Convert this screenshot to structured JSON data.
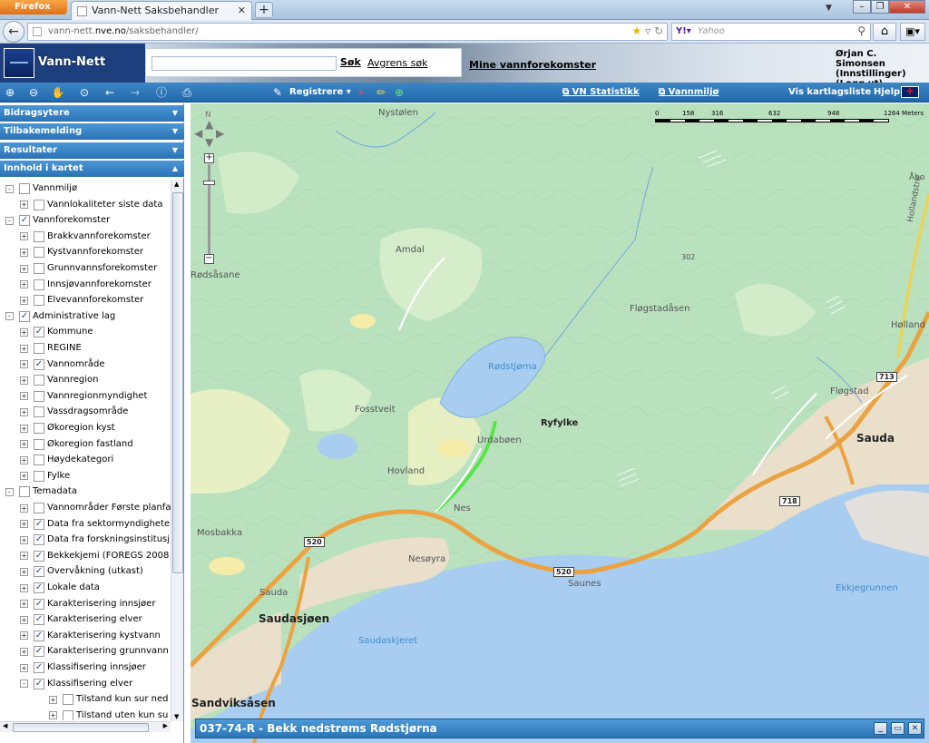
{
  "browser": {
    "app_menu": "Firefox",
    "tab_title": "Vann-Nett Saksbehandler",
    "url_plain": "vann-nett.",
    "url_host": "nve.no",
    "url_path": "/saksbehandler/",
    "search_engine_placeholder": "Yahoo"
  },
  "header": {
    "app_title": "Vann-Nett",
    "search_button": "Søk",
    "refine_button": "Avgrens søk",
    "my_waters_link": "Mine vannforekomster",
    "user_name": "Ørjan C. Simonsen",
    "settings_link": "(Innstillinger)",
    "logout_link": "(Logg ut)"
  },
  "toolbar": {
    "register_label": "Registrere",
    "vn_stats": "VN Statistikk",
    "vannmiljo": "Vannmiljø",
    "layer_list": "Vis kartlagsliste",
    "help": "Hjelp"
  },
  "sidebar": {
    "panels": [
      "Bidragsytere",
      "Tilbakemelding",
      "Resultater",
      "Innhold i kartet"
    ],
    "tree": [
      {
        "level": 0,
        "label": "Vannmiljø",
        "checked": false,
        "exp": "-"
      },
      {
        "level": 1,
        "label": "Vannlokaliteter siste data",
        "checked": false,
        "exp": "+"
      },
      {
        "level": 0,
        "label": "Vannforekomster",
        "checked": true,
        "exp": "-"
      },
      {
        "level": 1,
        "label": "Brakkvannforekomster",
        "checked": false,
        "exp": "+"
      },
      {
        "level": 1,
        "label": "Kystvannforekomster",
        "checked": false,
        "exp": "+"
      },
      {
        "level": 1,
        "label": "Grunnvannsforekomster",
        "checked": false,
        "exp": "+"
      },
      {
        "level": 1,
        "label": "Innsjøvannforekomster",
        "checked": false,
        "exp": "+"
      },
      {
        "level": 1,
        "label": "Elvevannforekomster",
        "checked": false,
        "exp": "+"
      },
      {
        "level": 0,
        "label": "Administrative lag",
        "checked": true,
        "exp": "-"
      },
      {
        "level": 1,
        "label": "Kommune",
        "checked": true,
        "exp": "+"
      },
      {
        "level": 1,
        "label": "REGINE",
        "checked": false,
        "exp": "+"
      },
      {
        "level": 1,
        "label": "Vannområde",
        "checked": true,
        "exp": "+"
      },
      {
        "level": 1,
        "label": "Vannregion",
        "checked": false,
        "exp": "+"
      },
      {
        "level": 1,
        "label": "Vannregionmyndighet",
        "checked": false,
        "exp": "+"
      },
      {
        "level": 1,
        "label": "Vassdragsområde",
        "checked": false,
        "exp": "+"
      },
      {
        "level": 1,
        "label": "Økoregion kyst",
        "checked": false,
        "exp": "+"
      },
      {
        "level": 1,
        "label": "Økoregion fastland",
        "checked": false,
        "exp": "+"
      },
      {
        "level": 1,
        "label": "Høydekategori",
        "checked": false,
        "exp": "+"
      },
      {
        "level": 1,
        "label": "Fylke",
        "checked": false,
        "exp": "+"
      },
      {
        "level": 0,
        "label": "Temadata",
        "checked": false,
        "exp": "-"
      },
      {
        "level": 1,
        "label": "Vannområder Første planfa",
        "checked": false,
        "exp": "+"
      },
      {
        "level": 1,
        "label": "Data fra sektormyndighete",
        "checked": true,
        "exp": "+"
      },
      {
        "level": 1,
        "label": "Data fra forskningsinstitusj",
        "checked": true,
        "exp": "+"
      },
      {
        "level": 1,
        "label": "Bekkekjemi (FOREGS 2008",
        "checked": true,
        "exp": "+"
      },
      {
        "level": 1,
        "label": "Overvåkning (utkast)",
        "checked": true,
        "exp": "+"
      },
      {
        "level": 1,
        "label": "Lokale data",
        "checked": true,
        "exp": "+"
      },
      {
        "level": 1,
        "label": "Karakterisering innsjøer",
        "checked": true,
        "exp": "+"
      },
      {
        "level": 1,
        "label": "Karakterisering elver",
        "checked": true,
        "exp": "+"
      },
      {
        "level": 1,
        "label": "Karakterisering kystvann",
        "checked": true,
        "exp": "+"
      },
      {
        "level": 1,
        "label": "Karakterisering grunnvann",
        "checked": true,
        "exp": "+"
      },
      {
        "level": 1,
        "label": "Klassifisering innsjøer",
        "checked": true,
        "exp": "+"
      },
      {
        "level": 1,
        "label": "Klassifisering elver",
        "checked": true,
        "exp": "-"
      },
      {
        "level": 2,
        "label": "Tilstand kun sur ned",
        "checked": false,
        "exp": "+"
      },
      {
        "level": 2,
        "label": "Tilstand uten kun su",
        "checked": false,
        "exp": "+"
      }
    ]
  },
  "map": {
    "north_label": "N",
    "scale_labels": [
      "0",
      "158",
      "316",
      "632",
      "948",
      "1264 Meters"
    ],
    "places": [
      {
        "id": "nystolen",
        "text": "Nystølen",
        "cls": ""
      },
      {
        "id": "amdal",
        "text": "Amdal",
        "cls": ""
      },
      {
        "id": "rodsasane",
        "text": "Rødsåsane",
        "cls": ""
      },
      {
        "id": "h302",
        "text": "302",
        "cls": ""
      },
      {
        "id": "flogstadasen",
        "text": "Fløgstadåsen",
        "cls": ""
      },
      {
        "id": "holland",
        "text": "Hølland",
        "cls": ""
      },
      {
        "id": "rodstjorna",
        "text": "Rødstjørna",
        "cls": "water"
      },
      {
        "id": "fosstveit",
        "text": "Fosstveit",
        "cls": ""
      },
      {
        "id": "ryfylke",
        "text": "Ryfylke",
        "cls": "bold"
      },
      {
        "id": "flogstad",
        "text": "Fløgstad",
        "cls": ""
      },
      {
        "id": "sauda",
        "text": "Sauda",
        "cls": "big bold"
      },
      {
        "id": "hovland",
        "text": "Hovland",
        "cls": ""
      },
      {
        "id": "urdaboen",
        "text": "Urdabøen",
        "cls": ""
      },
      {
        "id": "nes",
        "text": "Nes",
        "cls": ""
      },
      {
        "id": "mosbakka",
        "text": "Mosbakka",
        "cls": ""
      },
      {
        "id": "nesoyra",
        "text": "Nesøyra",
        "cls": ""
      },
      {
        "id": "saunes",
        "text": "Saunes",
        "cls": ""
      },
      {
        "id": "sauda2",
        "text": "Sauda",
        "cls": ""
      },
      {
        "id": "saudasjoen",
        "text": "Saudasjøen",
        "cls": "big bold"
      },
      {
        "id": "saudaskjeret",
        "text": "Saudaskjeret",
        "cls": "water"
      },
      {
        "id": "ekkjegrunnen",
        "text": "Ekkjegrunnen",
        "cls": "water"
      },
      {
        "id": "sandviksasen",
        "text": "Sandviksåsen",
        "cls": "big bold"
      },
      {
        "id": "abo",
        "text": "Åbo",
        "cls": ""
      },
      {
        "id": "hollandstre",
        "text": "Hollandstre",
        "cls": ""
      }
    ],
    "road_labels": {
      "r718": "718",
      "r713": "713",
      "r520a": "520",
      "r520b": "520"
    },
    "popup_title": "037-74-R - Bekk nedstrøms Rødstjørna"
  }
}
